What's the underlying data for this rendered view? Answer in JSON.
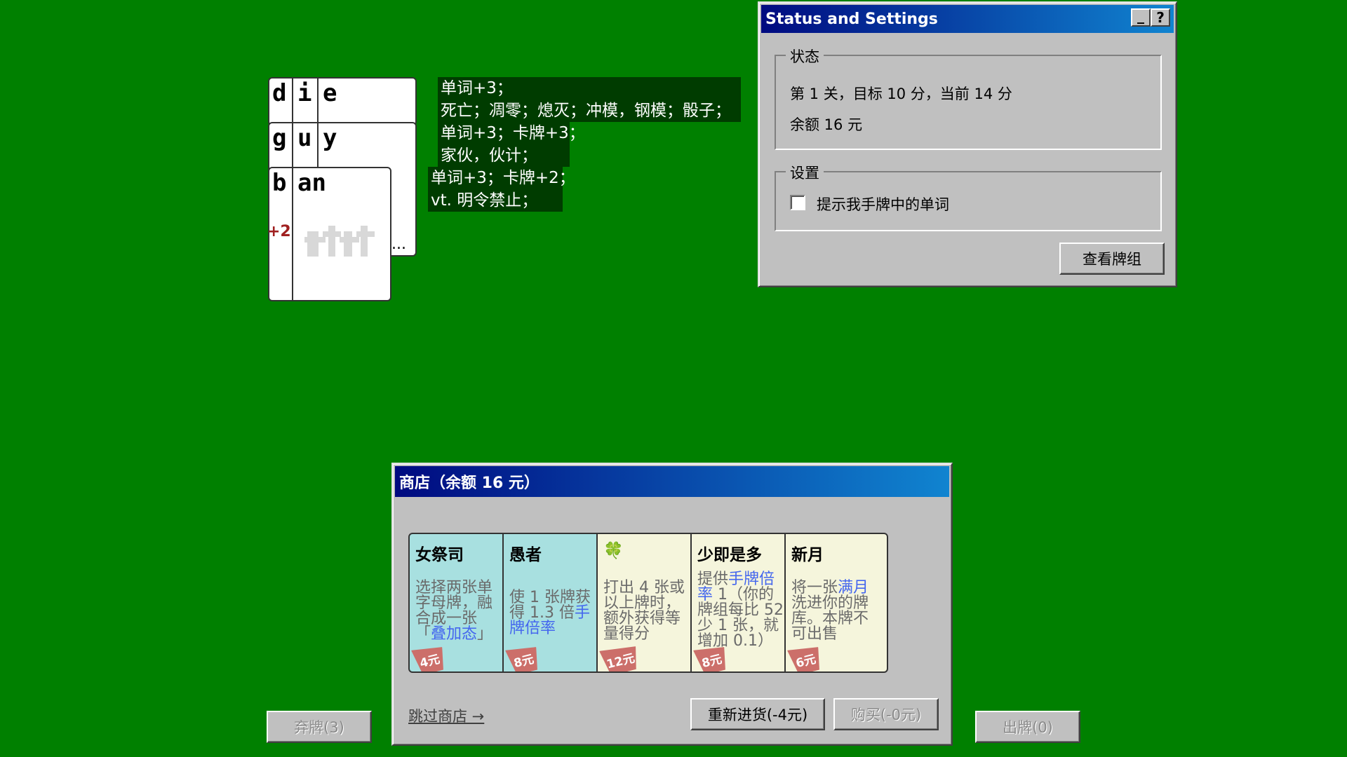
{
  "played_words": [
    {
      "letters": [
        "d",
        "i",
        "e"
      ],
      "extra": ""
    },
    {
      "letters": [
        "g",
        "u",
        "y"
      ],
      "extra": ""
    },
    {
      "letters": [
        "b",
        "an"
      ],
      "extra": "+2"
    }
  ],
  "overflow_marker": "...",
  "definitions": [
    {
      "line1": "单词+3；",
      "line2": "死亡；凋零；熄灭；冲模，钢模；骰子；"
    },
    {
      "line1": "单词+3；卡牌+3；",
      "line2": "家伙，伙计；"
    },
    {
      "line1": "单词+3；卡牌+2；",
      "line2": "vt. 明令禁止；"
    }
  ],
  "status_window": {
    "title": "Status and Settings",
    "minimize_glyph": "_",
    "help_glyph": "?",
    "status_group_label": "状态",
    "level_text": "第 1 关，目标 10 分，当前 14 分",
    "balance_text": "余额 16 元",
    "settings_group_label": "设置",
    "hint_checkbox_label": "提示我手牌中的单词",
    "hint_checked": false,
    "view_deck_button": "查看牌组"
  },
  "shop": {
    "title": "商店（余额 16 元）",
    "cards": [
      {
        "name": "女祭司",
        "desc_parts": [
          "选择两张单字母牌，融合成一张「",
          "叠加态",
          "」"
        ],
        "price": "4元",
        "bg": "#a8e0e0"
      },
      {
        "name": "愚者",
        "desc_parts": [
          "使 1 张牌获得 1.3 倍",
          "手牌倍率",
          ""
        ],
        "price": "8元",
        "bg": "#a8e0e0"
      },
      {
        "name": "🍀",
        "desc_parts": [
          "打出 4 张或以上牌时，额外获得等量得分",
          "",
          ""
        ],
        "price": "12元",
        "bg": "#f5f5dc"
      },
      {
        "name": "少即是多",
        "desc_parts": [
          "提供",
          "手牌倍率",
          " 1（你的牌组每比 52 少 1 张，就增加 0.1）"
        ],
        "price": "8元",
        "bg": "#f5f5dc"
      },
      {
        "name": "新月",
        "desc_parts": [
          "将一张",
          "满月",
          "洗进你的牌库。本牌不可出售"
        ],
        "price": "6元",
        "bg": "#f5f5dc"
      }
    ],
    "skip_link": "跳过商店 →",
    "reroll_button": "重新进货(-4元)",
    "buy_button": "购买(-0元)"
  },
  "discard_button": "弃牌(3)",
  "play_button": "出牌(0)",
  "colors": {
    "table": "#008000",
    "title_start": "#000a80",
    "title_end": "#1084d0",
    "price_tag": "#cc6f6a"
  }
}
